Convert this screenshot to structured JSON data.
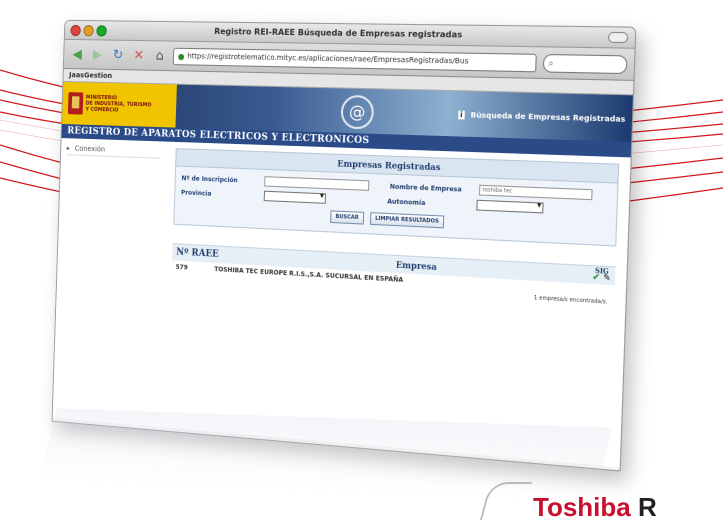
{
  "window": {
    "title": "Registro REI-RAEE Búsqueda de Empresas registradas",
    "url": "https://registrotelematico.mityc.es/aplicaciones/raee/EmpresasRegistradas/Bus",
    "bookmark": "JaasGestion"
  },
  "banner": {
    "ministry": [
      "Ministerio",
      "de Industria, Turismo",
      "y Comercio"
    ],
    "link_label": "Búsqueda de Empresas Registradas",
    "subtitle": "REGISTRO DE APARATOS ELECTRICOS Y ELECTRONICOS"
  },
  "sidebar": {
    "items": [
      {
        "label": "Conexión"
      }
    ]
  },
  "search_panel": {
    "title": "Empresas Registradas",
    "inscription_label": "Nº de Inscripción",
    "company_label": "Nombre de Empresa",
    "company_value": "toshiba tec",
    "province_label": "Provincia",
    "autonomy_label": "Autonomía",
    "search_button": "BUSCAR",
    "clear_button": "LIMPIAR RESULTADOS"
  },
  "results": {
    "col_num": "Nº RAEE",
    "col_company": "Empresa",
    "col_sig": "SIG",
    "rows": [
      {
        "num": "579",
        "company": "TOSHIBA TEC EUROPE R.I.S.,S.A. SUCURSAL EN ESPAÑA"
      }
    ],
    "footer": "1 empresa/s encontrada/s."
  },
  "brand": {
    "part1": "Toshiba",
    "part2": "R"
  },
  "colors": {
    "accent": "#c8102e",
    "banner": "#2a4a88",
    "ministry": "#f1c400"
  }
}
